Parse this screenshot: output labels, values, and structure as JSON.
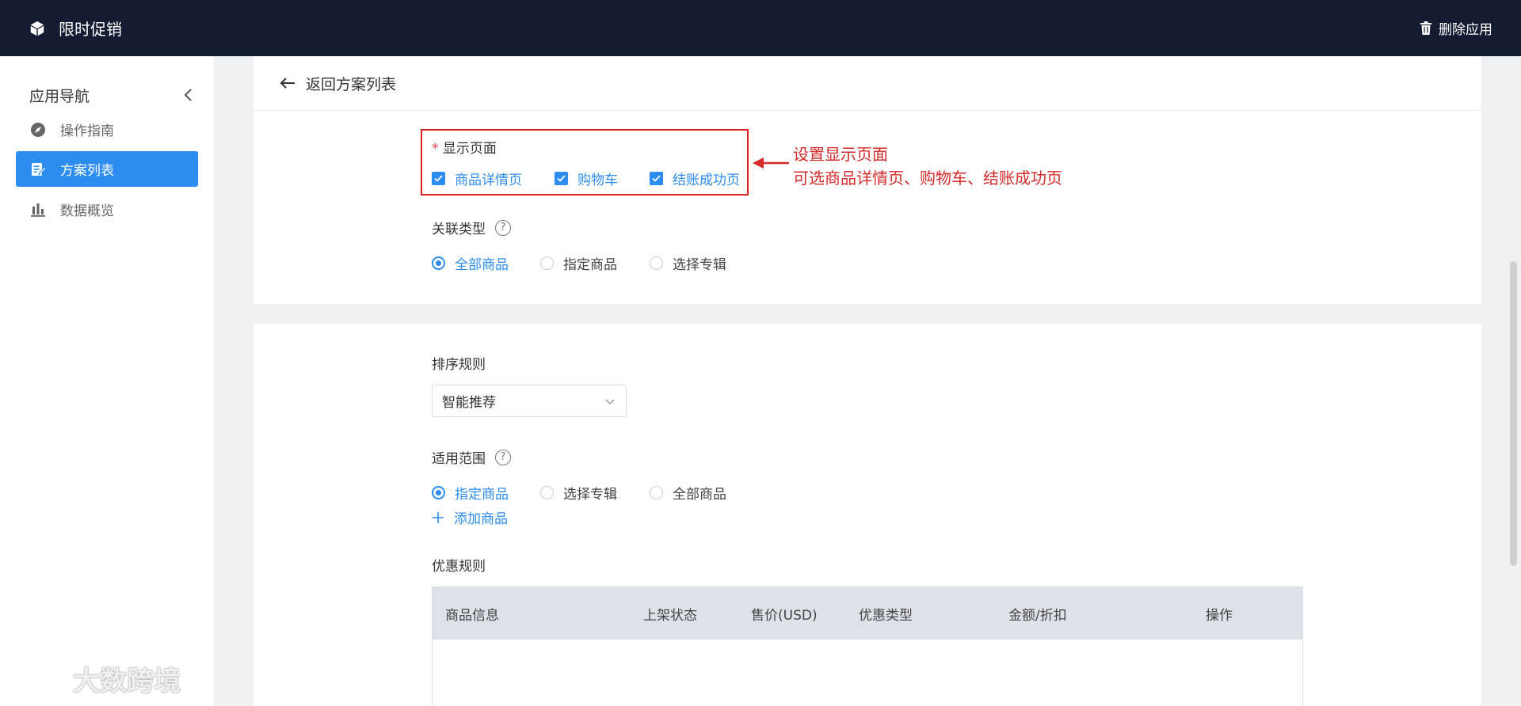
{
  "topbar": {
    "title": "限时促销",
    "delete_label": "删除应用"
  },
  "sidebar": {
    "heading": "应用导航",
    "items": [
      {
        "label": "操作指南",
        "icon": "compass-icon",
        "active": false
      },
      {
        "label": "方案列表",
        "icon": "edit-list-icon",
        "active": true
      },
      {
        "label": "数据概览",
        "icon": "bar-chart-icon",
        "active": false
      }
    ]
  },
  "back_label": "返回方案列表",
  "display_page": {
    "label": "显示页面",
    "required_mark": "*",
    "options": [
      "商品详情页",
      "购物车",
      "结账成功页"
    ]
  },
  "annotation": {
    "line1": "设置显示页面",
    "line2": "可选商品详情页、购物车、结账成功页"
  },
  "link_type": {
    "label": "关联类型",
    "options": [
      "全部商品",
      "指定商品",
      "选择专辑"
    ],
    "selected": "全部商品"
  },
  "sort_rule": {
    "label": "排序规则",
    "value": "智能推荐"
  },
  "scope": {
    "label": "适用范围",
    "options": [
      "指定商品",
      "选择专辑",
      "全部商品"
    ],
    "selected": "指定商品",
    "add_label": "添加商品"
  },
  "discount_rules": {
    "label": "优惠规则",
    "columns": [
      "商品信息",
      "上架状态",
      "售价(USD)",
      "优惠类型",
      "金额/折扣",
      "操作"
    ]
  },
  "watermark": "大数跨境",
  "colors": {
    "accent": "#2d8cf0",
    "topbar": "#141c33",
    "annotation": "#d42a2a"
  }
}
